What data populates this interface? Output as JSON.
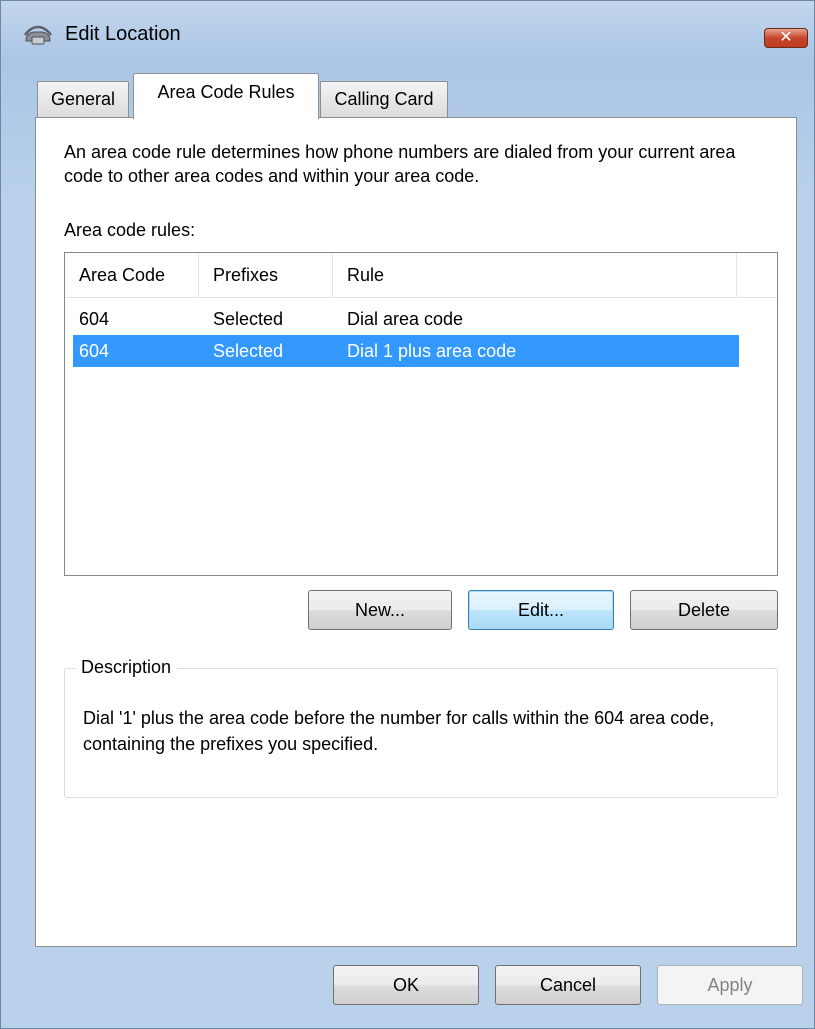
{
  "window": {
    "title": "Edit Location",
    "close_label": "✕"
  },
  "tabs": [
    {
      "label": "General"
    },
    {
      "label": "Area Code Rules"
    },
    {
      "label": "Calling Card"
    }
  ],
  "panel": {
    "intro": "An area code rule determines how phone numbers are dialed from your current area code to other area codes and within your area code.",
    "rules_label": "Area code rules:",
    "columns": [
      "Area Code",
      "Prefixes",
      "Rule"
    ],
    "rows": [
      {
        "area_code": "604",
        "prefixes": "Selected",
        "rule": "Dial area code"
      },
      {
        "area_code": "604",
        "prefixes": "Selected",
        "rule": "Dial 1 plus area code"
      }
    ],
    "buttons": {
      "new": "New...",
      "edit": "Edit...",
      "delete": "Delete"
    },
    "description": {
      "legend": "Description",
      "text": "Dial '1' plus the area code before the number for calls within the 604 area code, containing the prefixes you specified."
    }
  },
  "footer": {
    "ok": "OK",
    "cancel": "Cancel",
    "apply": "Apply"
  },
  "colors": {
    "selection": "#3399ff",
    "close_button": "#c7452a"
  },
  "icons": {
    "app": "phone-dialing-icon",
    "close": "close-icon"
  }
}
